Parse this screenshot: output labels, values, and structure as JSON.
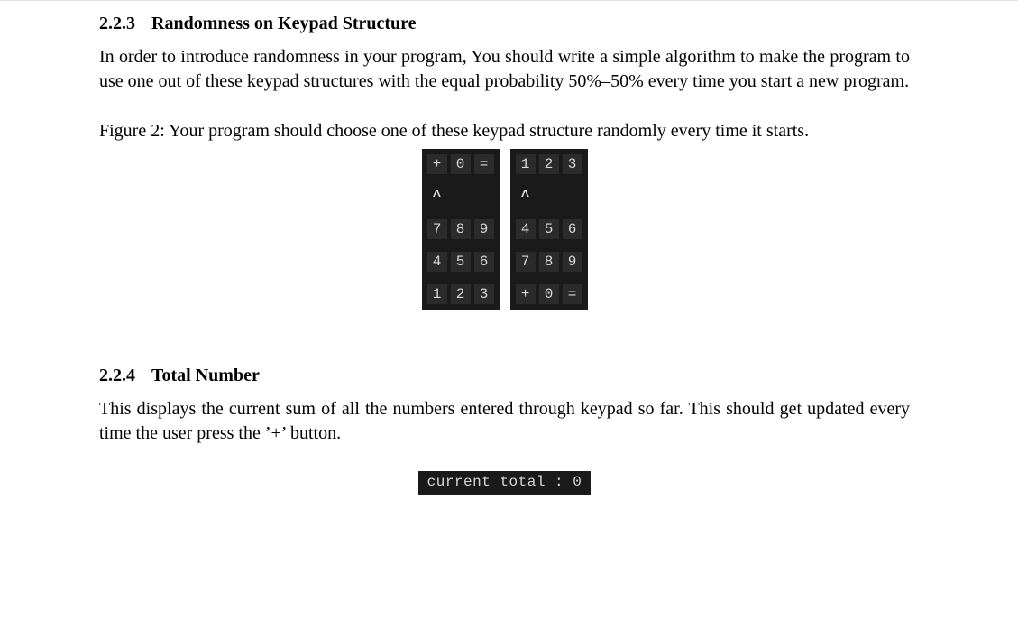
{
  "section1": {
    "number": "2.2.3",
    "title": "Randomness on Keypad Structure",
    "paragraph": "In order to introduce randomness in your program, You should write a simple algorithm to make the program to use one out of these keypad structures with the equal probability 50%–50% every time you start a new program."
  },
  "figure": {
    "caption_prefix": "Figure 2:",
    "caption_text": "Your program should choose one of these keypad structure randomly every time it starts.",
    "keypad_left": {
      "row0": [
        "+",
        "0",
        "="
      ],
      "caret": "^",
      "row2": [
        "7",
        "8",
        "9"
      ],
      "row3": [
        "4",
        "5",
        "6"
      ],
      "row4": [
        "1",
        "2",
        "3"
      ]
    },
    "keypad_right": {
      "row0": [
        "1",
        "2",
        "3"
      ],
      "caret": "^",
      "row2": [
        "4",
        "5",
        "6"
      ],
      "row3": [
        "7",
        "8",
        "9"
      ],
      "row4": [
        "+",
        "0",
        "="
      ]
    }
  },
  "section2": {
    "number": "2.2.4",
    "title": "Total Number",
    "paragraph": "This displays the current sum of all the numbers entered through keypad so far. This should get updated every time the user press the ’+’ button."
  },
  "total_display": {
    "label": "current total : 0"
  }
}
